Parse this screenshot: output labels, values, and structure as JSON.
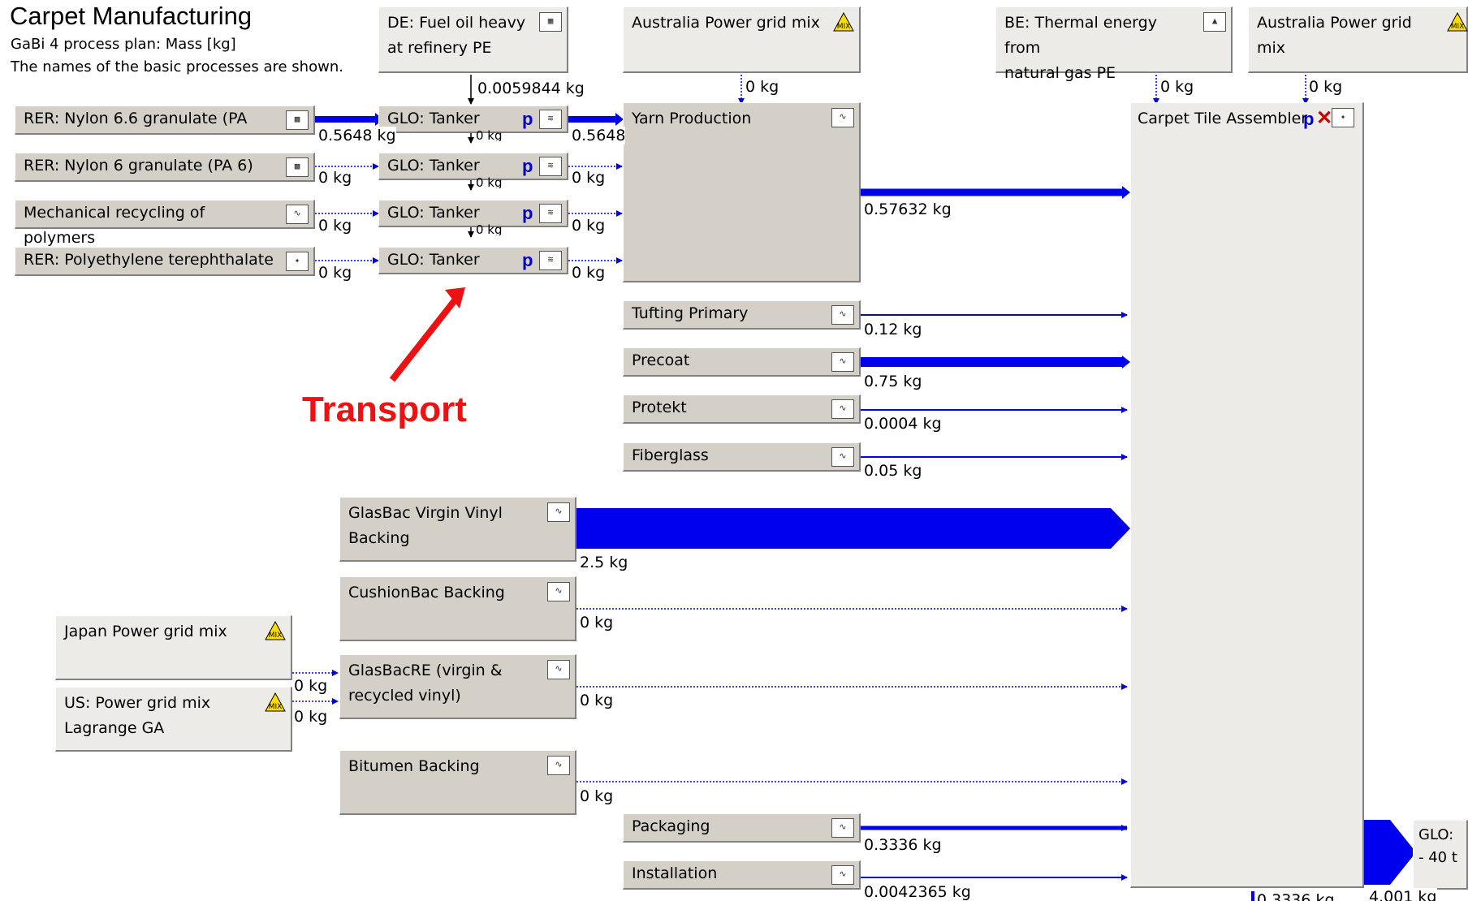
{
  "header": {
    "title": "Carpet Manufacturing",
    "subtitle": "GaBi 4 process plan: Mass [kg]",
    "note": "The names of the basic processes are shown."
  },
  "processes": {
    "fuel_oil": "DE: Fuel oil heavy\nat refinery PE",
    "aus_grid_1": "Australia Power grid mix",
    "be_thermal": "BE: Thermal energy from\nnatural gas PE",
    "aus_grid_2": "Australia Power grid mix",
    "nylon66": "RER: Nylon 6.6 granulate (PA",
    "nylon6": "RER: Nylon 6 granulate (PA 6)",
    "mech_recycling": "Mechanical recycling of polymers",
    "pet": "RER: Polyethylene terephthalate",
    "tanker_1": "GLO: Tanker",
    "tanker_2": "GLO: Tanker",
    "tanker_3": "GLO: Tanker",
    "tanker_4": "GLO: Tanker",
    "yarn": "Yarn Production",
    "assembler": "Carpet Tile Assembler",
    "tufting": "Tufting Primary",
    "precoat": "Precoat",
    "protekt": "Protekt",
    "fiberglass": "Fiberglass",
    "glasbac_virgin": "GlasBac Virgin Vinyl\nBacking",
    "cushionbac": "CushionBac Backing",
    "japan_grid": "Japan Power grid mix",
    "glasbac_re": "GlasBacRE (virgin &\nrecycled vinyl)",
    "us_grid": "US: Power grid mix\nLagrange GA",
    "bitumen": "Bitumen Backing",
    "packaging": "Packaging",
    "installation": "Installation",
    "glo_partial": "GLO:\n- 40 t"
  },
  "flows": {
    "fuel_oil_to_tanker": "0.0059844 kg",
    "aus1_to_yarn": "0 kg",
    "be_to_assembler": "0 kg",
    "aus2_to_assembler": "0 kg",
    "nylon66_to_tanker": "0.5648 kg",
    "nylon6_to_tanker": "0 kg",
    "mech_to_tanker": "0 kg",
    "pet_to_tanker": "0 kg",
    "tanker_2_in": "0 kg",
    "tanker_3_in": "0 kg",
    "tanker_4_in": "0 kg",
    "tanker1_to_yarn": "0.5648",
    "tanker2_to_yarn": "0 kg",
    "tanker3_to_yarn": "0 kg",
    "tanker4_to_yarn": "0 kg",
    "yarn_to_assembler": "0.57632 kg",
    "tufting_out": "0.12 kg",
    "precoat_out": "0.75 kg",
    "protekt_out": "0.0004 kg",
    "fiberglass_out": "0.05 kg",
    "glasbac_virgin_out": "2.5 kg",
    "cushionbac_out": "0 kg",
    "japan_to_glasbacre": "0 kg",
    "us_to_glasbacre": "0 kg",
    "glasbacre_out": "0 kg",
    "bitumen_out": "0 kg",
    "packaging_out": "0.3336 kg",
    "installation_out": "0.0042365 kg",
    "bottom_left": "0.3336 kg",
    "assembler_out": "4.001 kg"
  },
  "annotation": {
    "text": "Transport",
    "color": "#ee1111"
  },
  "icons": {
    "plan_icon": "plan-icon",
    "warning_mix_icon": "power-grid-mix-icon",
    "fuel_icon": "fuel-oil-icon",
    "granulate_icon": "granulate-icon",
    "tanker_icon": "tanker-icon",
    "thermal_icon": "thermal-energy-icon"
  },
  "colors": {
    "flow": "#0000ee",
    "process_fill": "#d4d0c8",
    "annotation": "#ee1111"
  }
}
